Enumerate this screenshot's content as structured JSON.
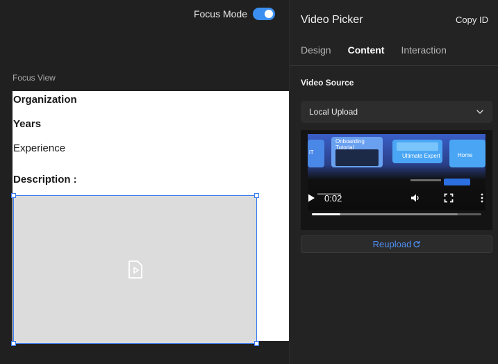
{
  "canvas": {
    "focus_mode": {
      "label": "Focus Mode",
      "enabled": true
    },
    "focus_view_label": "Focus View",
    "preview": {
      "fields": [
        {
          "label": "Organization",
          "bold": true
        },
        {
          "label": "Years",
          "bold": true
        },
        {
          "label": "Experience",
          "bold": false
        },
        {
          "label": "Description :",
          "bold": true
        }
      ],
      "video_placeholder": {
        "icon": "video-file-icon"
      }
    }
  },
  "panel": {
    "title": "Video Picker",
    "copy_id": "Copy ID",
    "tabs": [
      {
        "label": "Design",
        "active": false
      },
      {
        "label": "Content",
        "active": true
      },
      {
        "label": "Interaction",
        "active": false
      }
    ],
    "video_source": {
      "title": "Video Source",
      "selected": "Local Upload",
      "video": {
        "thumbnail_texts": [
          "Onboarding Tutorial",
          "Ultimate Expert",
          "Home"
        ],
        "current_time": "0:02",
        "progress": 0.17,
        "buffered": 0.86
      },
      "reupload_label": "Reupload"
    }
  },
  "colors": {
    "accent": "#3b8ff0",
    "link": "#4e8ff5",
    "selection": "#3b7cf0"
  }
}
